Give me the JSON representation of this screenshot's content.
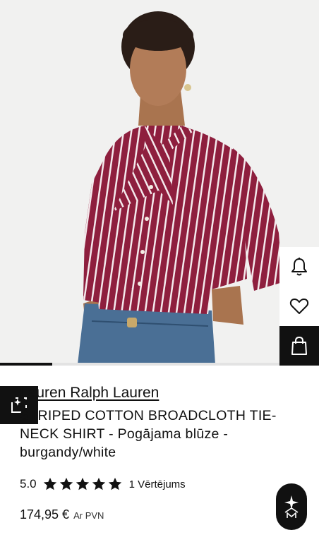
{
  "product": {
    "brand": "Lauren Ralph Lauren",
    "title": "STRIPED COTTON BROADCLOTH TIE-NECK SHIRT - Pogājama blūze - burgandy/white",
    "rating_value": "5.0",
    "rating_stars": 5,
    "reviews_label": "1 Vērtējums",
    "price": "174,95 €",
    "vat_label": "Ar PVN"
  },
  "gallery": {
    "image_count_hint": "1 of 6",
    "progress_fraction": 0.16
  },
  "icons": {
    "notify": "bell-icon",
    "wishlist": "heart-icon",
    "bag": "shopping-bag-icon",
    "try_on": "sparkle-frame-icon",
    "assistant": "assistant-icon"
  },
  "colors": {
    "accent": "#111111",
    "shirt": "#8e1f3e",
    "background": "#f1f1f0"
  }
}
